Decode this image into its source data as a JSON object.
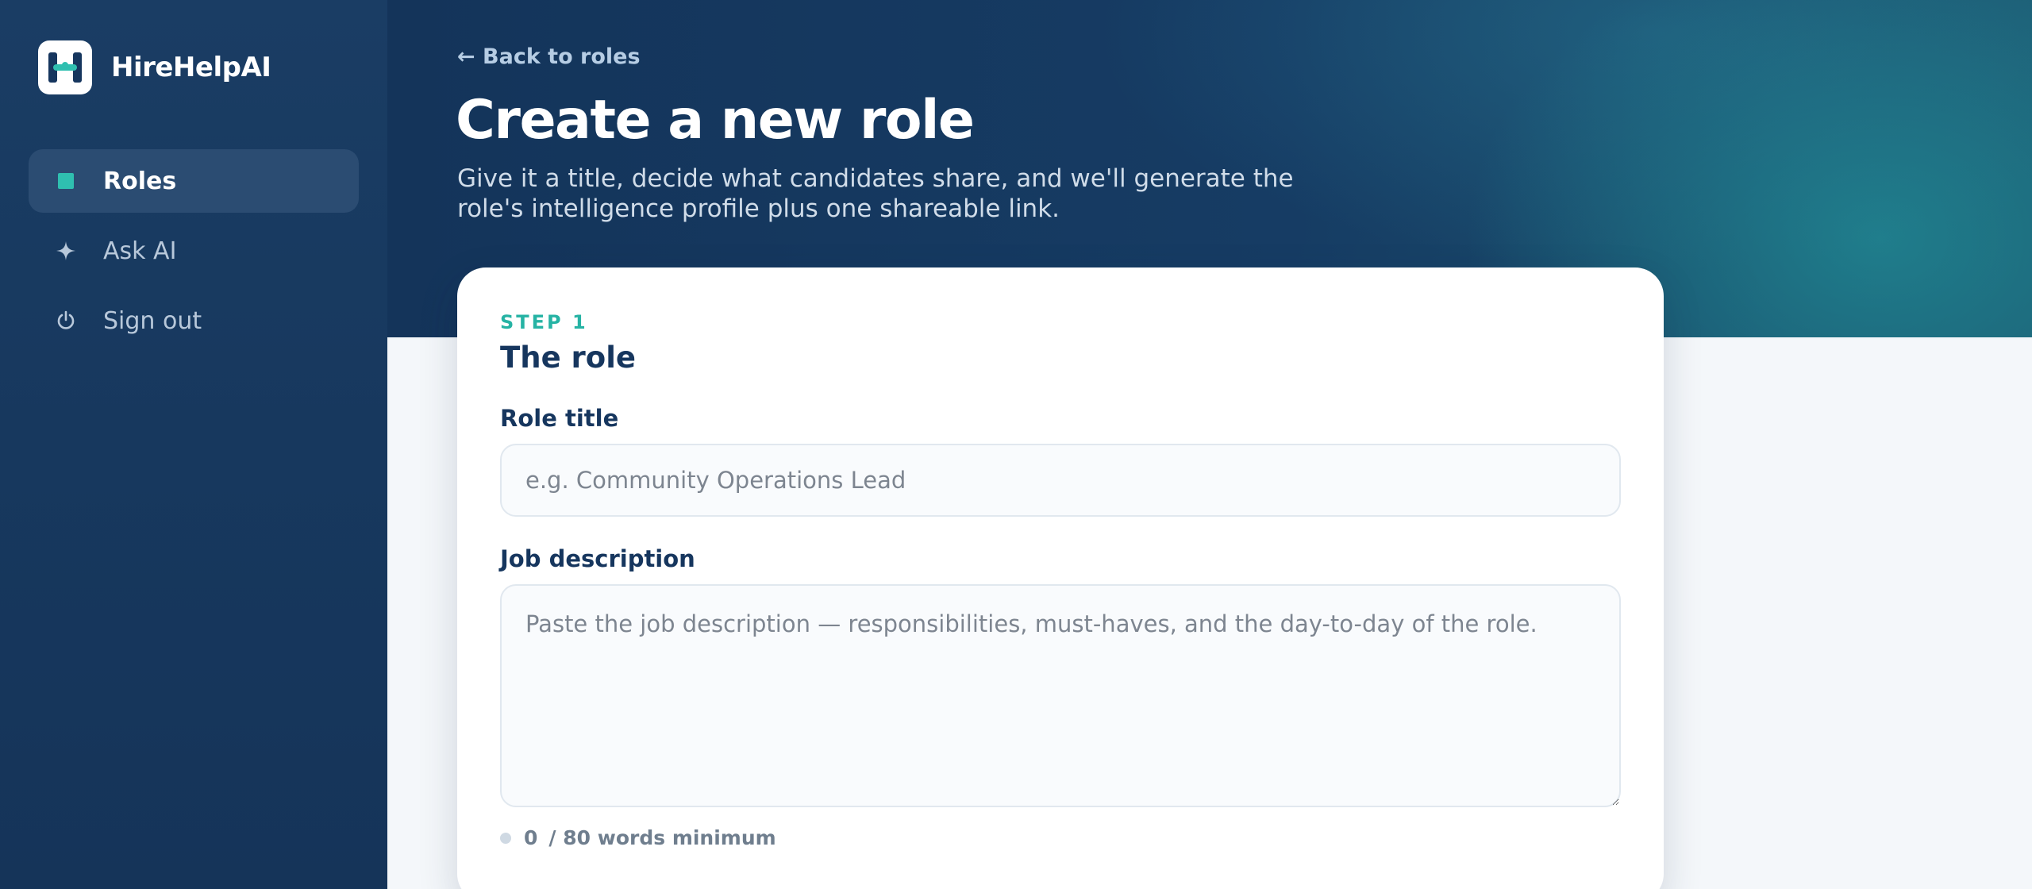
{
  "app": {
    "name": "HireHelpAI"
  },
  "sidebar": {
    "items": [
      {
        "label": "Roles",
        "icon": "square-icon",
        "active": true
      },
      {
        "label": "Ask AI",
        "icon": "sparkle-icon",
        "active": false
      },
      {
        "label": "Sign out",
        "icon": "power-icon",
        "active": false
      }
    ]
  },
  "header": {
    "back_link": "← Back to roles",
    "title": "Create a new role",
    "subtitle": "Give it a title, decide what candidates share, and we'll generate the role's intelligence profile plus one shareable link."
  },
  "form": {
    "step_label": "STEP 1",
    "section_title": "The role",
    "role_title": {
      "label": "Role title",
      "value": "",
      "placeholder": "e.g. Community Operations Lead"
    },
    "job_description": {
      "label": "Job description",
      "value": "",
      "placeholder": "Paste the job description — responsibilities, must-haves, and the day-to-day of the role."
    },
    "word_count": {
      "current": "0",
      "suffix": "/ 80 words minimum"
    }
  },
  "colors": {
    "sidebar_bg": "#17385e",
    "accent_teal": "#2fbfb0",
    "step_label": "#26b3a4",
    "heading_navy": "#16365e"
  }
}
